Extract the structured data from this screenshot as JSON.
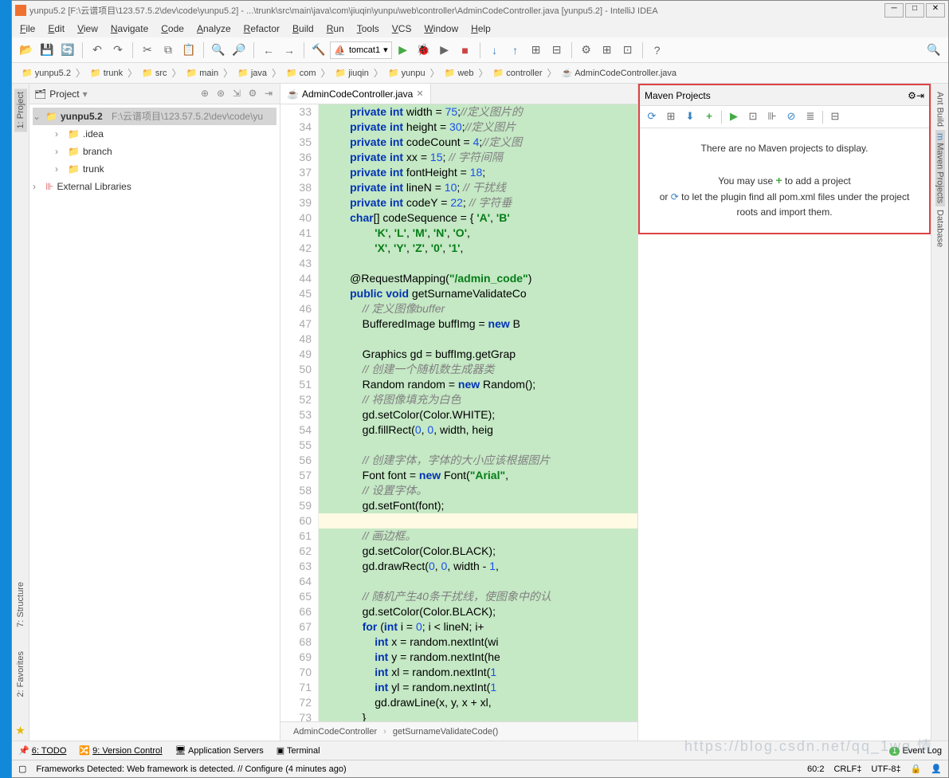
{
  "title": "yunpu5.2 [F:\\云谱项目\\123.57.5.2\\dev\\code\\yunpu5.2] - ...\\trunk\\src\\main\\java\\com\\jiuqin\\yunpu\\web\\controller\\AdminCodeController.java [yunpu5.2] - IntelliJ IDEA",
  "menus": [
    "File",
    "Edit",
    "View",
    "Navigate",
    "Code",
    "Analyze",
    "Refactor",
    "Build",
    "Run",
    "Tools",
    "VCS",
    "Window",
    "Help"
  ],
  "run_config": "tomcat1",
  "breadcrumb": [
    "yunpu5.2",
    "trunk",
    "src",
    "main",
    "java",
    "com",
    "jiuqin",
    "yunpu",
    "web",
    "controller",
    "AdminCodeController.java"
  ],
  "project_panel": {
    "title": "Project",
    "root": "yunpu5.2",
    "root_path": "F:\\云谱项目\\123.57.5.2\\dev\\code\\yu",
    "children": [
      ".idea",
      "branch",
      "trunk"
    ],
    "external": "External Libraries"
  },
  "editor_tab": "AdminCodeController.java",
  "code": {
    "first_line": 33,
    "lines": [
      {
        "t": "hl",
        "h": "        <span class='k'>private</span> <span class='k'>int</span> width = <span class='n'>75</span>;<span class='c'>//定义图片的</span>"
      },
      {
        "t": "hl",
        "h": "        <span class='k'>private</span> <span class='k'>int</span> height = <span class='n'>30</span>;<span class='c'>//定义图片</span>"
      },
      {
        "t": "hl",
        "h": "        <span class='k'>private</span> <span class='k'>int</span> codeCount = <span class='n'>4</span>;<span class='c'>//定义图</span>"
      },
      {
        "t": "hl",
        "h": "        <span class='k'>private</span> <span class='k'>int</span> xx = <span class='n'>15</span>; <span class='c'>// 字符间隔</span>"
      },
      {
        "t": "hl",
        "h": "        <span class='k'>private</span> <span class='k'>int</span> fontHeight = <span class='n'>18</span>;"
      },
      {
        "t": "hl",
        "h": "        <span class='k'>private</span> <span class='k'>int</span> lineN = <span class='n'>10</span>; <span class='c'>// 干扰线</span>"
      },
      {
        "t": "hl",
        "h": "        <span class='k'>private</span> <span class='k'>int</span> codeY = <span class='n'>22</span>; <span class='c'>// 字符垂</span>"
      },
      {
        "t": "hl",
        "h": "        <span class='k'>char</span>[] codeSequence = { <span class='s'>'A'</span>, <span class='s'>'B'</span>"
      },
      {
        "t": "hl",
        "h": "                <span class='s'>'K'</span>, <span class='s'>'L'</span>, <span class='s'>'M'</span>, <span class='s'>'N'</span>, <span class='s'>'O'</span>,"
      },
      {
        "t": "hl",
        "h": "                <span class='s'>'X'</span>, <span class='s'>'Y'</span>, <span class='s'>'Z'</span>, <span class='s'>'0'</span>, <span class='s'>'1'</span>,"
      },
      {
        "t": "hl",
        "h": ""
      },
      {
        "t": "hl",
        "h": "        @RequestMapping(<span class='s'>\"/admin_code\"</span>)"
      },
      {
        "t": "hl",
        "h": "        <span class='k'>public</span> <span class='k'>void</span> getSurnameValidateCo"
      },
      {
        "t": "hl",
        "h": "            <span class='c'>// 定义图像buffer</span>"
      },
      {
        "t": "hl",
        "h": "            BufferedImage buffImg = <span class='k'>new</span> B"
      },
      {
        "t": "hl",
        "h": ""
      },
      {
        "t": "hl",
        "h": "            Graphics gd = buffImg.getGrap"
      },
      {
        "t": "hl",
        "h": "            <span class='c'>// 创建一个随机数生成器类</span>"
      },
      {
        "t": "hl",
        "h": "            Random random = <span class='k'>new</span> Random();"
      },
      {
        "t": "hl",
        "h": "            <span class='c'>// 将图像填充为白色</span>"
      },
      {
        "t": "hl",
        "h": "            gd.setColor(Color.WHITE);"
      },
      {
        "t": "hl",
        "h": "            gd.fillRect(<span class='n'>0</span>, <span class='n'>0</span>, width, heig"
      },
      {
        "t": "hl",
        "h": ""
      },
      {
        "t": "hl",
        "h": "            <span class='c'>// 创建字体，字体的大小应该根据图片</span>"
      },
      {
        "t": "hl",
        "h": "            Font font = <span class='k'>new</span> Font(<span class='s'>\"Arial\"</span>,"
      },
      {
        "t": "hl",
        "h": "            <span class='c'>// 设置字体。</span>"
      },
      {
        "t": "hl",
        "h": "            gd.setFont(font);"
      },
      {
        "t": "cur",
        "h": ""
      },
      {
        "t": "hl",
        "h": "            <span class='c'>// 画边框。</span>"
      },
      {
        "t": "hl",
        "h": "            gd.setColor(Color.BLACK);"
      },
      {
        "t": "hl",
        "h": "            gd.drawRect(<span class='n'>0</span>, <span class='n'>0</span>, width - <span class='n'>1</span>,"
      },
      {
        "t": "hl",
        "h": ""
      },
      {
        "t": "hl",
        "h": "            <span class='c'>// 随机产生40条干扰线，使图象中的认</span>"
      },
      {
        "t": "hl",
        "h": "            gd.setColor(Color.BLACK);"
      },
      {
        "t": "hl",
        "h": "            <span class='k'>for</span> (<span class='k'>int</span> i = <span class='n'>0</span>; i &lt; lineN; i+"
      },
      {
        "t": "hl",
        "h": "                <span class='k'>int</span> x = random.nextInt(wi"
      },
      {
        "t": "hl",
        "h": "                <span class='k'>int</span> y = random.nextInt(he"
      },
      {
        "t": "hl",
        "h": "                <span class='k'>int</span> xl = random.nextInt(<span class='n'>1</span>"
      },
      {
        "t": "hl",
        "h": "                <span class='k'>int</span> yl = random.nextInt(<span class='n'>1</span>"
      },
      {
        "t": "hl",
        "h": "                gd.drawLine(x, y, x + xl,"
      },
      {
        "t": "hl",
        "h": "            }"
      },
      {
        "t": "nh",
        "h": ""
      }
    ]
  },
  "editor_breadcrumb": [
    "AdminCodeController",
    "getSurnameValidateCode()"
  ],
  "maven": {
    "title": "Maven Projects",
    "empty1": "There are no Maven projects to display.",
    "empty2": "You may use",
    "empty3": "to add a project",
    "empty4": "or",
    "empty5": "to let the plugin find all pom.xml files under the project roots and import them."
  },
  "right_tabs": [
    "Ant Build",
    "Maven Projects",
    "Database"
  ],
  "left_tabs_bottom": [
    "Structure",
    "Favorites"
  ],
  "left_tab_top": "Project",
  "bottom_tools": {
    "todo": "6: TODO",
    "vcs": "9: Version Control",
    "appsrv": "Application Servers",
    "term": "Terminal",
    "eventlog": "Event Log",
    "event_count": "1"
  },
  "status": {
    "msg": "Frameworks Detected: Web framework is detected. // Configure (4 minutes ago)",
    "pos": "60:2",
    "eol": "CRLF‡",
    "enc": "UTF-8‡"
  }
}
